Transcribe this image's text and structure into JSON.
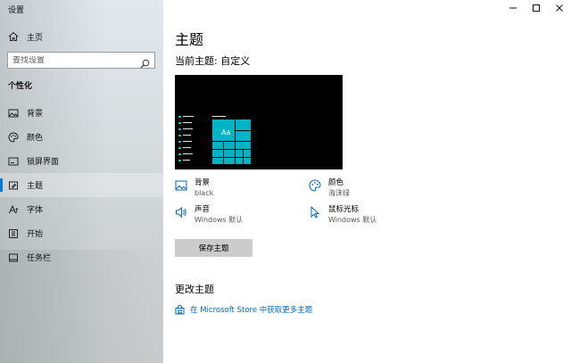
{
  "window": {
    "title": "设置",
    "controls": {
      "minimize": "—",
      "maximize": "□",
      "close": "✕"
    }
  },
  "sidebar": {
    "home_label": "主页",
    "search_placeholder": "查找设置",
    "section_title": "个性化",
    "items": [
      {
        "label": "背景",
        "icon": "picture-icon"
      },
      {
        "label": "颜色",
        "icon": "palette-icon"
      },
      {
        "label": "锁屏界面",
        "icon": "lockscreen-icon"
      },
      {
        "label": "主题",
        "icon": "theme-icon",
        "active": true
      },
      {
        "label": "字体",
        "icon": "font-icon"
      },
      {
        "label": "开始",
        "icon": "start-icon"
      },
      {
        "label": "任务栏",
        "icon": "taskbar-icon"
      }
    ]
  },
  "main": {
    "title": "主题",
    "current_theme": "当前主题: 自定义",
    "properties": [
      {
        "name": "背景",
        "value": "black",
        "icon": "picture-icon"
      },
      {
        "name": "颜色",
        "value": "海沫绿",
        "icon": "palette-icon"
      },
      {
        "name": "声音",
        "value": "Windows 默认",
        "icon": "speaker-icon"
      },
      {
        "name": "鼠标光标",
        "value": "Windows 默认",
        "icon": "cursor-icon"
      }
    ],
    "save_button": "保存主题",
    "change_title": "更改主题",
    "store_link": "在 Microsoft Store 中获取更多主题",
    "preview_tile_text": "Aa"
  },
  "colors": {
    "accent": "#00b4c5",
    "link": "#0067c0",
    "nav_indicator": "#0078d4",
    "preview_background": "#000000"
  }
}
